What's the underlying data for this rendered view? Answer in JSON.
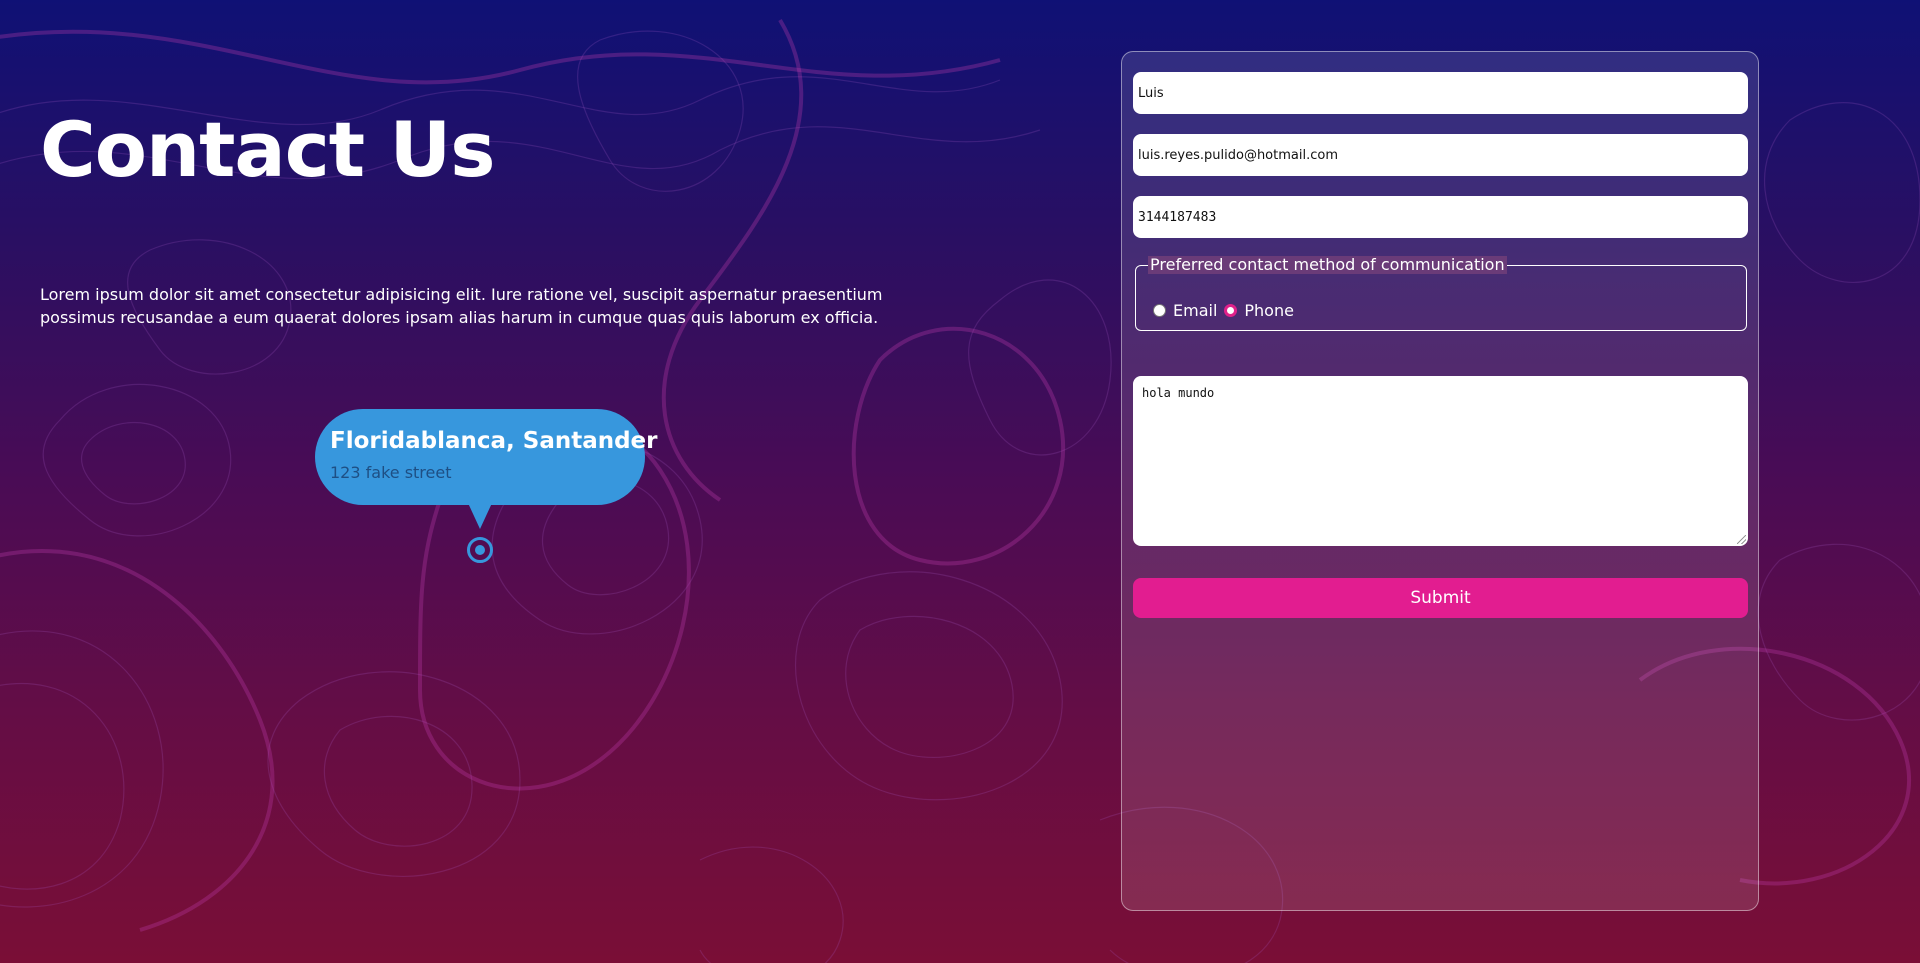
{
  "header": {
    "title": "Contact Us",
    "description": "Lorem ipsum dolor sit amet consectetur adipisicing elit. Iure ratione vel, suscipit aspernatur praesentium possimus recusandae a eum quaerat dolores ipsam alias harum in cumque quas quis laborum ex officia."
  },
  "location": {
    "city": "Floridablanca, Santander",
    "street": "123 fake street",
    "pin_icon": "map-pin-icon"
  },
  "form": {
    "name_value": "Luis",
    "email_value": "luis.reyes.pulido@hotmail.com",
    "phone_value": "3144187483",
    "contact_method": {
      "legend": "Preferred contact method of communication",
      "options": [
        "Email",
        "Phone"
      ],
      "selected": "Phone"
    },
    "message_value": "hola mundo",
    "submit_label": "Submit"
  },
  "colors": {
    "background_top": "#0f1175",
    "background_bottom": "#7a0e36",
    "accent": "#e21d90",
    "bubble": "#3797dd"
  }
}
